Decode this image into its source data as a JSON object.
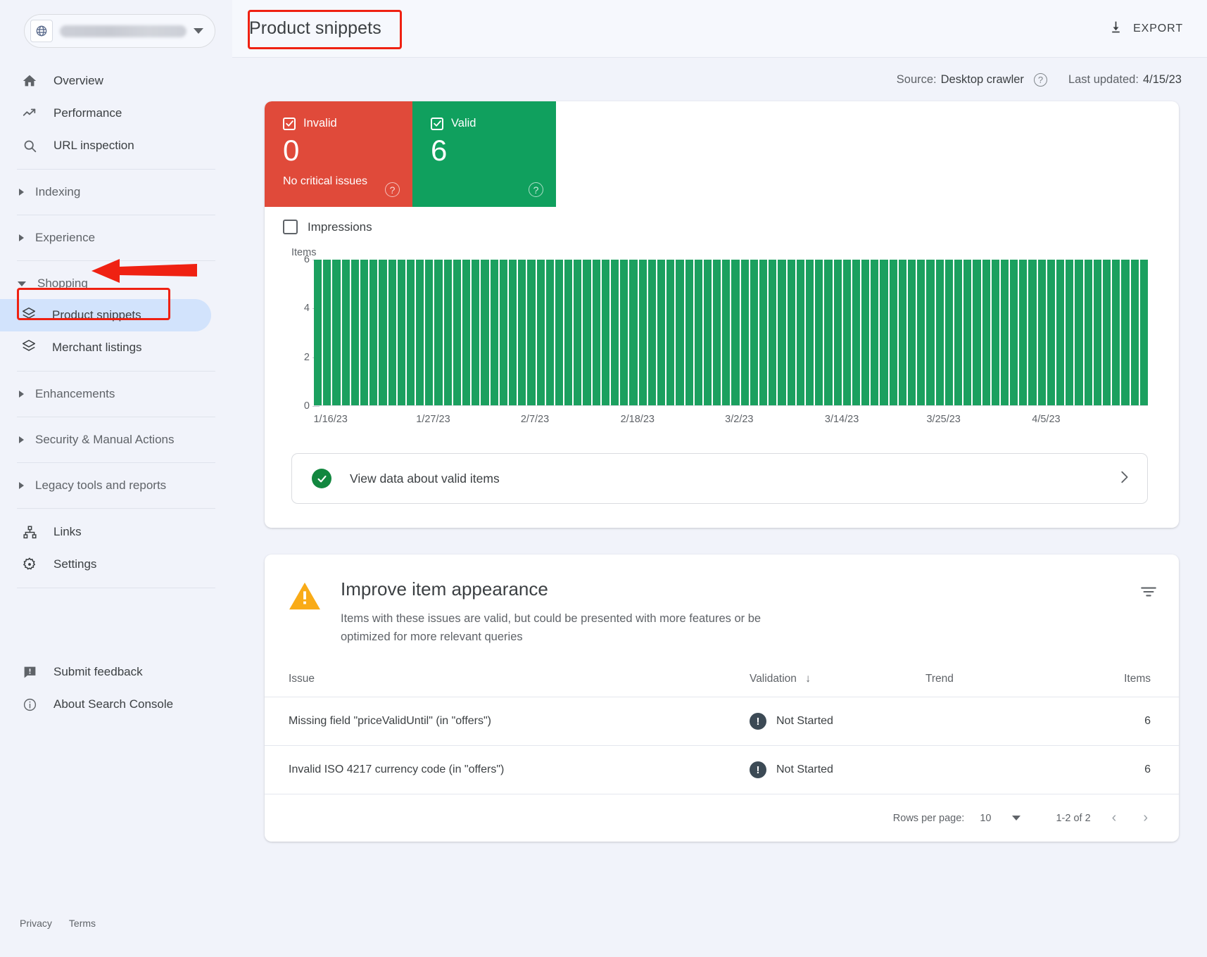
{
  "sidebar": {
    "property_selector": {
      "name": "property-selector",
      "icon": "globe-icon"
    },
    "items": [
      {
        "label": "Overview",
        "icon": "home-icon"
      },
      {
        "label": "Performance",
        "icon": "trending-up-icon"
      },
      {
        "label": "URL inspection",
        "icon": "search-icon"
      }
    ],
    "groups": [
      {
        "label": "Indexing",
        "expanded": false
      },
      {
        "label": "Experience",
        "expanded": false
      },
      {
        "label": "Shopping",
        "expanded": true
      },
      {
        "label": "Enhancements",
        "expanded": false
      },
      {
        "label": "Security & Manual Actions",
        "expanded": false
      },
      {
        "label": "Legacy tools and reports",
        "expanded": false
      }
    ],
    "shopping_children": [
      {
        "label": "Product snippets",
        "icon": "layers-icon",
        "active": true
      },
      {
        "label": "Merchant listings",
        "icon": "layers-icon",
        "active": false
      }
    ],
    "tools": [
      {
        "label": "Links",
        "icon": "sitemap-icon"
      },
      {
        "label": "Settings",
        "icon": "gear-icon"
      }
    ],
    "bottom": [
      {
        "label": "Submit feedback",
        "icon": "feedback-icon"
      },
      {
        "label": "About Search Console",
        "icon": "info-icon"
      }
    ],
    "footer": [
      "Privacy",
      "Terms"
    ]
  },
  "header": {
    "title": "Product snippets",
    "export_label": "EXPORT",
    "export_icon": "download-icon",
    "source_label": "Source:",
    "source_value": "Desktop crawler",
    "source_help_icon": "help-circle-icon",
    "last_updated_label": "Last updated:",
    "last_updated_value": "4/15/23"
  },
  "status": {
    "invalid": {
      "label": "Invalid",
      "count": "0",
      "sub": "No critical issues",
      "color": "#e04a3a",
      "checked": true,
      "help_icon": "help-circle-icon"
    },
    "valid": {
      "label": "Valid",
      "count": "6",
      "color": "#10a05e",
      "checked": true,
      "help_icon": "help-circle-icon"
    },
    "impressions": {
      "label": "Impressions",
      "checked": false
    }
  },
  "chart_data": {
    "type": "bar",
    "title": "",
    "ylabel": "Items",
    "xlabel": "",
    "ylim": [
      0,
      6
    ],
    "yticks": [
      0,
      2,
      4,
      6
    ],
    "grid": false,
    "legend": [
      "Valid",
      "Invalid",
      "Impressions"
    ],
    "series": [
      {
        "name": "Valid",
        "color": "#1ba05f",
        "values": [
          6,
          6,
          6,
          6,
          6,
          6,
          6,
          6,
          6,
          6,
          6,
          6,
          6,
          6,
          6,
          6,
          6,
          6,
          6,
          6,
          6,
          6,
          6,
          6,
          6,
          6,
          6,
          6,
          6,
          6,
          6,
          6,
          6,
          6,
          6,
          6,
          6,
          6,
          6,
          6,
          6,
          6,
          6,
          6,
          6,
          6,
          6,
          6,
          6,
          6,
          6,
          6,
          6,
          6,
          6,
          6,
          6,
          6,
          6,
          6,
          6,
          6,
          6,
          6,
          6,
          6,
          6,
          6,
          6,
          6,
          6,
          6,
          6,
          6,
          6,
          6,
          6,
          6,
          6,
          6,
          6,
          6,
          6,
          6,
          6,
          6,
          6,
          6,
          6,
          6
        ]
      }
    ],
    "x_tick_labels": [
      "1/16/23",
      "1/27/23",
      "2/7/23",
      "2/18/23",
      "3/2/23",
      "3/14/23",
      "3/25/23",
      "4/5/23"
    ],
    "x_tick_positions_pct": [
      2.0,
      14.3,
      26.5,
      38.8,
      51.0,
      63.3,
      75.5,
      87.8
    ]
  },
  "valid_items_link": {
    "label": "View data about valid items",
    "icon": "check-circle-icon",
    "chevron": "chevron-right-icon"
  },
  "improve": {
    "icon": "warning-triangle-icon",
    "title": "Improve item appearance",
    "description": "Items with these issues are valid, but could be presented with more features or be optimized for more relevant queries",
    "filter_icon": "filter-icon",
    "columns": [
      "Issue",
      "Validation",
      "Trend",
      "Items"
    ],
    "sort_column": "Validation",
    "sort_icon": "arrow-down-icon",
    "rows": [
      {
        "issue": "Missing field \"priceValidUntil\" (in \"offers\")",
        "validation": "Not Started",
        "validation_icon": "exclamation-circle-icon",
        "trend": "flat",
        "trend_color": "#eba61d",
        "items": "6"
      },
      {
        "issue": "Invalid ISO 4217 currency code (in \"offers\")",
        "validation": "Not Started",
        "validation_icon": "exclamation-circle-icon",
        "trend": "flat",
        "trend_color": "#eba61d",
        "items": "6"
      }
    ],
    "pagination": {
      "rows_per_page_label": "Rows per page:",
      "rows_per_page_value": "10",
      "range": "1-2 of 2",
      "prev_icon": "chevron-left-icon",
      "next_icon": "chevron-right-icon"
    }
  },
  "annotations": {
    "title_box": true,
    "product_snippets_box": true,
    "shopping_arrow": true,
    "color": "#ef2112"
  }
}
